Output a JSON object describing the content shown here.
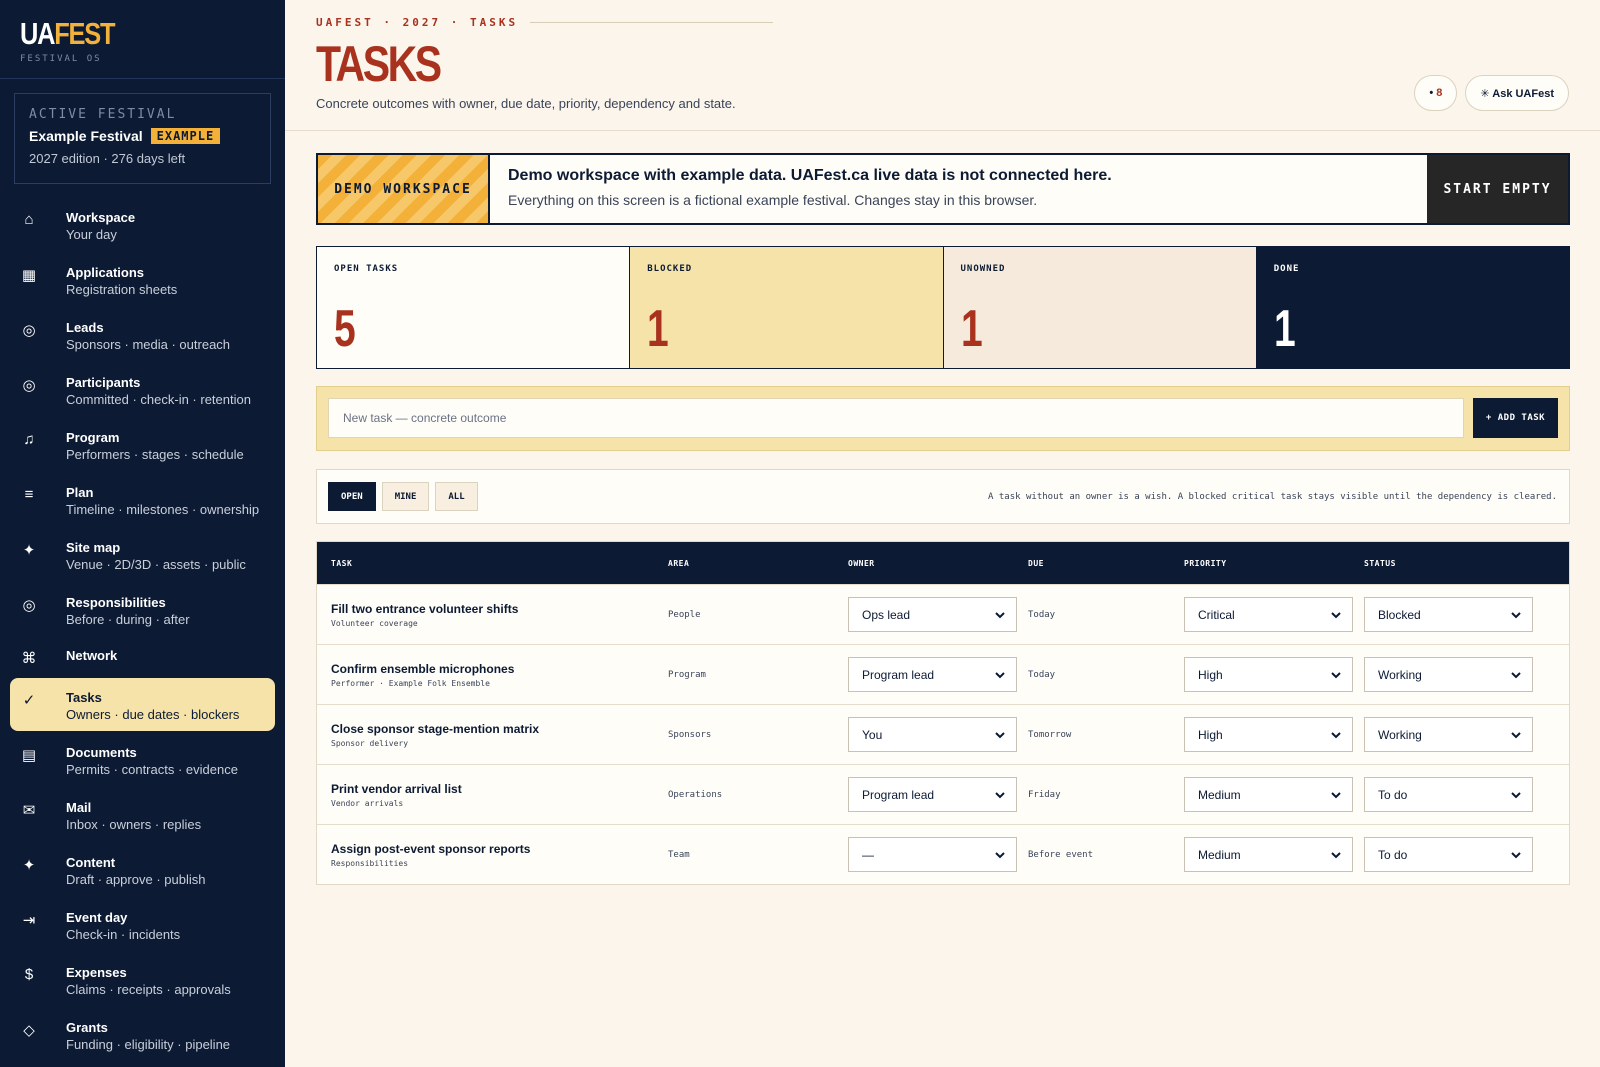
{
  "app": {
    "logo_ua": "UA",
    "logo_fest": "FEST",
    "logo_sub": "FESTIVAL OS"
  },
  "festival": {
    "label": "ACTIVE FESTIVAL",
    "name": "Example Festival",
    "badge": "EXAMPLE",
    "edition": "2027 edition · 276 days left"
  },
  "nav": [
    {
      "icon": "home-icon",
      "glyph": "⌂",
      "title": "Workspace",
      "sub": "Your day"
    },
    {
      "icon": "grid-icon",
      "glyph": "▦",
      "title": "Applications",
      "sub": "Registration sheets"
    },
    {
      "icon": "target-icon",
      "glyph": "◎",
      "title": "Leads",
      "sub": "Sponsors · media · outreach"
    },
    {
      "icon": "target-icon",
      "glyph": "◎",
      "title": "Participants",
      "sub": "Committed · check-in · retention"
    },
    {
      "icon": "music-note-icon",
      "glyph": "♫",
      "title": "Program",
      "sub": "Performers · stages · schedule"
    },
    {
      "icon": "list-icon",
      "glyph": "≡",
      "title": "Plan",
      "sub": "Timeline · milestones · ownership"
    },
    {
      "icon": "sparkle-icon",
      "glyph": "✦",
      "title": "Site map",
      "sub": "Venue · 2D/3D · assets · public"
    },
    {
      "icon": "target-icon",
      "glyph": "◎",
      "title": "Responsibilities",
      "sub": "Before · during · after"
    },
    {
      "icon": "command-icon",
      "glyph": "⌘",
      "title": "Network",
      "sub": ""
    },
    {
      "icon": "check-icon",
      "glyph": "✓",
      "title": "Tasks",
      "sub": "Owners · due dates · blockers"
    },
    {
      "icon": "document-icon",
      "glyph": "▤",
      "title": "Documents",
      "sub": "Permits · contracts · evidence"
    },
    {
      "icon": "mail-icon",
      "glyph": "✉",
      "title": "Mail",
      "sub": "Inbox · owners · replies"
    },
    {
      "icon": "star-icon",
      "glyph": "✦",
      "title": "Content",
      "sub": "Draft · approve · publish"
    },
    {
      "icon": "enter-icon",
      "glyph": "⇥",
      "title": "Event day",
      "sub": "Check-in · incidents"
    },
    {
      "icon": "dollar-icon",
      "glyph": "$",
      "title": "Expenses",
      "sub": "Claims · receipts · approvals"
    },
    {
      "icon": "diamond-icon",
      "glyph": "◇",
      "title": "Grants",
      "sub": "Funding · eligibility · pipeline"
    }
  ],
  "header": {
    "breadcrumb": "UAFEST · 2027 · TASKS",
    "title": "TASKS",
    "description": "Concrete outcomes with owner, due date, priority, dependency and state.",
    "notif_dot": "•",
    "notif_count": "8",
    "ask_label": "✳ Ask UAFest"
  },
  "demo": {
    "tag": "DEMO WORKSPACE",
    "title": "Demo workspace with example data. UAFest.ca live data is not connected here.",
    "sub": "Everything on this screen is a fictional example festival. Changes stay in this browser.",
    "button": "START EMPTY"
  },
  "stats": [
    {
      "label": "OPEN TASKS",
      "value": "5"
    },
    {
      "label": "BLOCKED",
      "value": "1"
    },
    {
      "label": "UNOWNED",
      "value": "1"
    },
    {
      "label": "DONE",
      "value": "1"
    }
  ],
  "add_task": {
    "placeholder": "New task — concrete outcome",
    "button": "+ ADD TASK"
  },
  "filters": {
    "chips": [
      "OPEN",
      "MINE",
      "ALL"
    ],
    "note": "A task without an owner is a wish. A blocked critical task stays visible until the dependency is cleared."
  },
  "table": {
    "headers": [
      "TASK",
      "AREA",
      "OWNER",
      "DUE",
      "PRIORITY",
      "STATUS"
    ],
    "rows": [
      {
        "title": "Fill two entrance volunteer shifts",
        "sub": "Volunteer coverage",
        "area": "People",
        "owner": "Ops lead",
        "due": "Today",
        "priority": "Critical",
        "status": "Blocked"
      },
      {
        "title": "Confirm ensemble microphones",
        "sub": "Performer · Example Folk Ensemble",
        "area": "Program",
        "owner": "Program lead",
        "due": "Today",
        "priority": "High",
        "status": "Working"
      },
      {
        "title": "Close sponsor stage-mention matrix",
        "sub": "Sponsor delivery",
        "area": "Sponsors",
        "owner": "You",
        "due": "Tomorrow",
        "priority": "High",
        "status": "Working"
      },
      {
        "title": "Print vendor arrival list",
        "sub": "Vendor arrivals",
        "area": "Operations",
        "owner": "Program lead",
        "due": "Friday",
        "priority": "Medium",
        "status": "To do"
      },
      {
        "title": "Assign post-event sponsor reports",
        "sub": "Responsibilities",
        "area": "Team",
        "owner": "—",
        "due": "Before event",
        "priority": "Medium",
        "status": "To do"
      }
    ]
  },
  "colors": {
    "navy": "#0c1a33",
    "accent_red": "#a8321e",
    "gold": "#f3b13a",
    "cream": "#fbf5ec"
  }
}
